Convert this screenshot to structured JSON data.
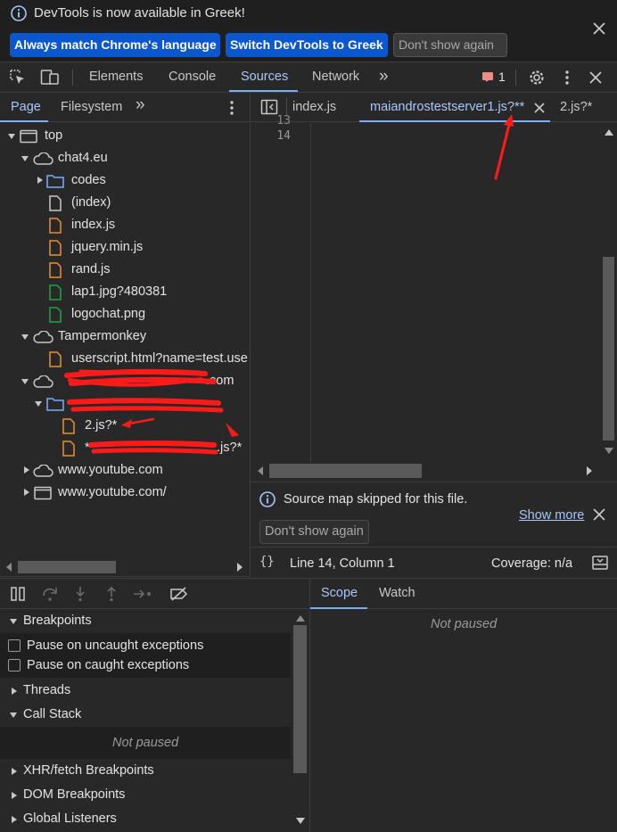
{
  "infobar": {
    "message": "DevTools is now available in Greek!",
    "btn_match": "Always match Chrome's language",
    "btn_switch": "Switch DevTools to Greek",
    "btn_dont_show": "Don't show again"
  },
  "toolbar": {
    "tabs": [
      "Elements",
      "Console",
      "Sources",
      "Network"
    ],
    "active_tab": "Sources",
    "issues_count": "1"
  },
  "navigator": {
    "tabs": [
      "Page",
      "Filesystem"
    ],
    "active_tab": "Page",
    "tree": [
      {
        "label": "top",
        "type": "frame"
      },
      {
        "label": "chat4.eu",
        "type": "domain"
      },
      {
        "label": "codes",
        "type": "folder"
      },
      {
        "label": "(index)",
        "type": "doc"
      },
      {
        "label": "index.js",
        "type": "script"
      },
      {
        "label": "jquery.min.js",
        "type": "script"
      },
      {
        "label": "rand.js",
        "type": "script"
      },
      {
        "label": "lap1.jpg?480381",
        "type": "image"
      },
      {
        "label": "logochat.png",
        "type": "image"
      },
      {
        "label": "Tampermonkey",
        "type": "domain"
      },
      {
        "label": "userscript.html?name=test.use",
        "type": "script"
      },
      {
        "label": ".com",
        "type": "domain"
      },
      {
        "label": "",
        "type": "folder"
      },
      {
        "label": "2.js?*",
        "type": "script"
      },
      {
        "label": ".js?*",
        "type": "script"
      },
      {
        "label": "www.youtube.com",
        "type": "domain"
      },
      {
        "label": "www.youtube.com/",
        "type": "frame"
      }
    ]
  },
  "editor": {
    "tabs": [
      "index.js",
      "maiandrostestserver1.js?**",
      "2.js?*"
    ],
    "active_tab": "maiandrostestserver1.js?**",
    "line_numbers": [
      "13",
      "14"
    ],
    "source_map_message": "Source map skipped for this file.",
    "show_more": "Show more",
    "dont_show_again": "Don't show again",
    "cursor_position": "Line 14, Column 1",
    "coverage": "Coverage: n/a"
  },
  "debugger": {
    "sections": {
      "breakpoints": "Breakpoints",
      "pause_uncaught": "Pause on uncaught exceptions",
      "pause_caught": "Pause on caught exceptions",
      "threads": "Threads",
      "call_stack": "Call Stack",
      "call_stack_status": "Not paused",
      "xhr": "XHR/fetch Breakpoints",
      "dom": "DOM Breakpoints",
      "global": "Global Listeners"
    },
    "scope_tabs": [
      "Scope",
      "Watch"
    ],
    "scope_status": "Not paused"
  },
  "colors": {
    "accent": "#a8c7fa",
    "primary_button": "#0b57d0",
    "script_icon": "#e8912d",
    "image_icon": "#1ea446",
    "folder_icon": "#7cacf8",
    "annotation": "#ff1a1a"
  }
}
